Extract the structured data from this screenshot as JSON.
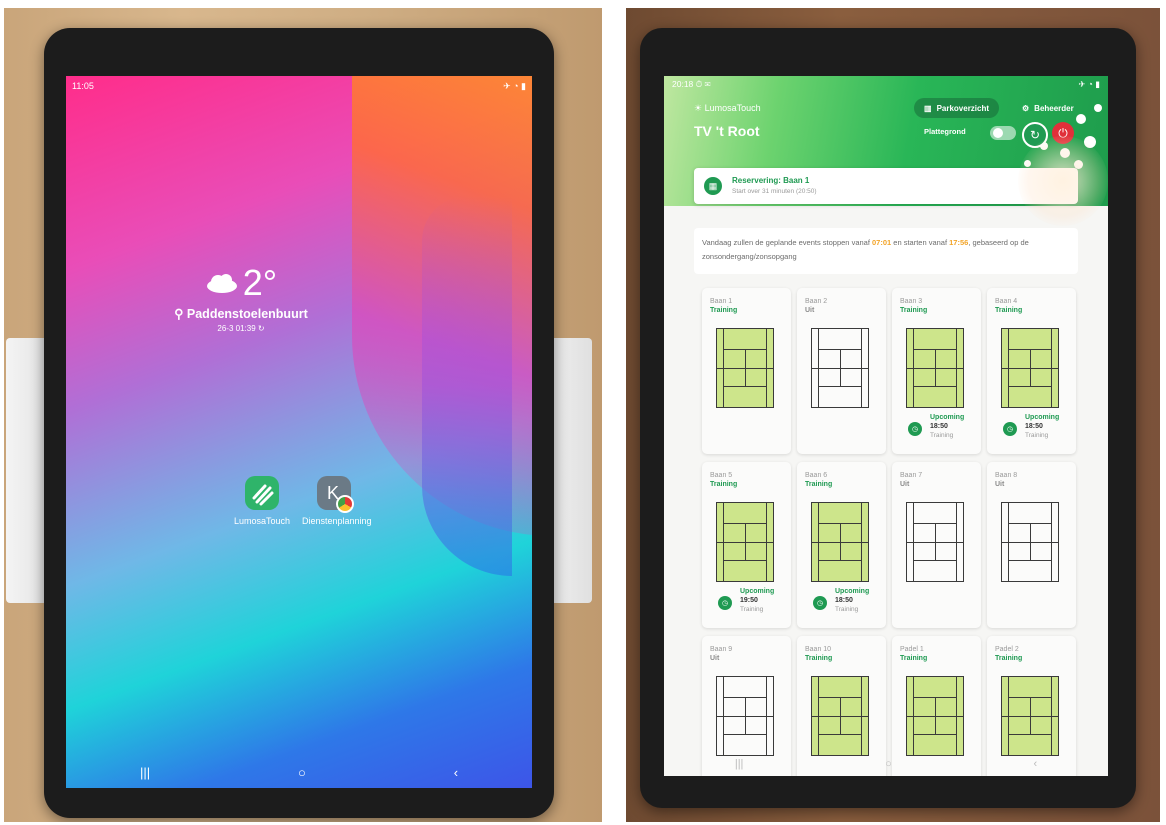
{
  "left": {
    "status": {
      "time": "11:05",
      "icons": "✈ ◔ ▮"
    },
    "weather": {
      "temp": "2°",
      "location": "Paddenstoelenbuurt",
      "updated": "26-3 01:39 ↻"
    },
    "apps": [
      {
        "label": "LumosaTouch",
        "color": "#2fb46a"
      },
      {
        "label": "Dienstenplanning",
        "color": "#6b7a86",
        "letter": "K"
      }
    ],
    "nav": [
      "|||",
      "○",
      "‹"
    ]
  },
  "right": {
    "status": {
      "time": "20:18 ⏱ ✉",
      "icons": "✈ ◔ ▮"
    },
    "brand": "LumosaTouch",
    "club": "TV 't Root",
    "buttons": {
      "parkoverzicht": "Parkoverzicht",
      "beheerder": "Beheerder",
      "plattegrond": "Plattegrond"
    },
    "reservation": {
      "title": "Reservering: Baan 1",
      "subtitle": "Start over 31 minuten (20:50)"
    },
    "notice": {
      "before": "Vandaag zullen de geplande events stoppen vanaf ",
      "stop": "07:01",
      "mid": " en starten vanaf ",
      "start": "17:56",
      "after": ", gebaseerd op de zonsondergang/zonsopgang"
    },
    "courts": [
      {
        "name": "Baan 1",
        "status": "Training",
        "active": true
      },
      {
        "name": "Baan 2",
        "status": "Uit",
        "active": false
      },
      {
        "name": "Baan 3",
        "status": "Training",
        "active": true,
        "upcoming": {
          "label": "Upcoming",
          "time": "18:50",
          "type": "Training"
        }
      },
      {
        "name": "Baan 4",
        "status": "Training",
        "active": true,
        "upcoming": {
          "label": "Upcoming",
          "time": "18:50",
          "type": "Training"
        }
      },
      {
        "name": "Baan 5",
        "status": "Training",
        "active": true,
        "upcoming": {
          "label": "Upcoming",
          "time": "19:50",
          "type": "Training"
        }
      },
      {
        "name": "Baan 6",
        "status": "Training",
        "active": true,
        "upcoming": {
          "label": "Upcoming",
          "time": "18:50",
          "type": "Training"
        }
      },
      {
        "name": "Baan 7",
        "status": "Uit",
        "active": false
      },
      {
        "name": "Baan 8",
        "status": "Uit",
        "active": false
      },
      {
        "name": "Baan 9",
        "status": "Uit",
        "active": false
      },
      {
        "name": "Baan 10",
        "status": "Training",
        "active": true
      },
      {
        "name": "Padel 1",
        "status": "Training",
        "active": true
      },
      {
        "name": "Padel 2",
        "status": "Training",
        "active": true
      }
    ],
    "nav": [
      "|||",
      "○",
      "‹"
    ]
  },
  "colors": {
    "green": "#1f9a52",
    "court_active": "#cde58b",
    "highlight": "#f2a428",
    "power": "#e0303a"
  }
}
